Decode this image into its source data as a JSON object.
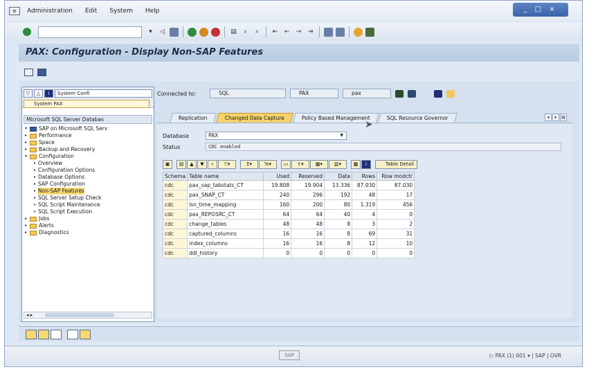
{
  "menubar": {
    "items": [
      "Administration",
      "Edit",
      "System",
      "Help"
    ],
    "window_controls": "_ □ ×"
  },
  "page_title": "PAX: Configuration - Display Non-SAP Features",
  "left_panel": {
    "system_config_label": "System Confi",
    "system_select": "System PAX",
    "header": "Microsoft SQL Server Databas",
    "tree": [
      {
        "label": "SAP on Microsoft SQL Serv",
        "level": 0,
        "type": "root"
      },
      {
        "label": "Performance",
        "level": 0,
        "type": "folder"
      },
      {
        "label": "Space",
        "level": 0,
        "type": "folder"
      },
      {
        "label": "Backup and Recovery",
        "level": 0,
        "type": "folder"
      },
      {
        "label": "Configuration",
        "level": 0,
        "type": "folder-open"
      },
      {
        "label": "Overview",
        "level": 1,
        "type": "item"
      },
      {
        "label": "Configuration Options",
        "level": 1,
        "type": "item"
      },
      {
        "label": "Database Options",
        "level": 1,
        "type": "item"
      },
      {
        "label": "SAP Configuration",
        "level": 1,
        "type": "item"
      },
      {
        "label": "Non-SAP Features",
        "level": 1,
        "type": "item",
        "selected": true
      },
      {
        "label": "SQL Server Setup Check",
        "level": 1,
        "type": "item"
      },
      {
        "label": "SQL Script Maintenance",
        "level": 1,
        "type": "item"
      },
      {
        "label": "SQL Script Execution",
        "level": 1,
        "type": "item"
      },
      {
        "label": "Jobs",
        "level": 0,
        "type": "folder"
      },
      {
        "label": "Alerts",
        "level": 0,
        "type": "folder"
      },
      {
        "label": "Diagnostics",
        "level": 0,
        "type": "folder"
      }
    ]
  },
  "connection": {
    "label": "Connected to:",
    "db": "SQL",
    "instance": "PAX",
    "schema": "pax"
  },
  "tabs": [
    {
      "label": "Replication",
      "active": false
    },
    {
      "label": "Changed Data Capture",
      "active": true
    },
    {
      "label": "Policy Based Management",
      "active": false
    },
    {
      "label": "SQL Resource Governor",
      "active": false
    }
  ],
  "form": {
    "database_label": "Database",
    "database_value": "PAX",
    "status_label": "Status",
    "status_value": "CDC enabled"
  },
  "grid_toolbar": {
    "table_detail_label": "Table Detail"
  },
  "table": {
    "columns": [
      "Schema",
      "Table name",
      "Used",
      "Reserved",
      "Data",
      "Rows",
      "Row modctr"
    ],
    "rows": [
      [
        "cdc",
        "pax_sap_tabstats_CT",
        "19.808",
        "19.904",
        "13.336",
        "87.030",
        "87.030"
      ],
      [
        "cdc",
        "pax_SNAP_CT",
        "240",
        "296",
        "192",
        "48",
        "17"
      ],
      [
        "cdc",
        "lsn_time_mapping",
        "160",
        "200",
        "80",
        "1.319",
        "456"
      ],
      [
        "cdc",
        "pax_REPOSRC_CT",
        "64",
        "64",
        "40",
        "4",
        "0"
      ],
      [
        "cdc",
        "change_tables",
        "48",
        "48",
        "8",
        "3",
        "2"
      ],
      [
        "cdc",
        "captured_columns",
        "16",
        "16",
        "8",
        "69",
        "31"
      ],
      [
        "cdc",
        "index_columns",
        "16",
        "16",
        "8",
        "12",
        "10"
      ],
      [
        "cdc",
        "ddl_history",
        "0",
        "0",
        "0",
        "0",
        "0"
      ]
    ]
  },
  "statusbar": {
    "logo": "SAP",
    "system_info": "▷ PAX (1) 001 ▾ | SAP | OVR"
  }
}
